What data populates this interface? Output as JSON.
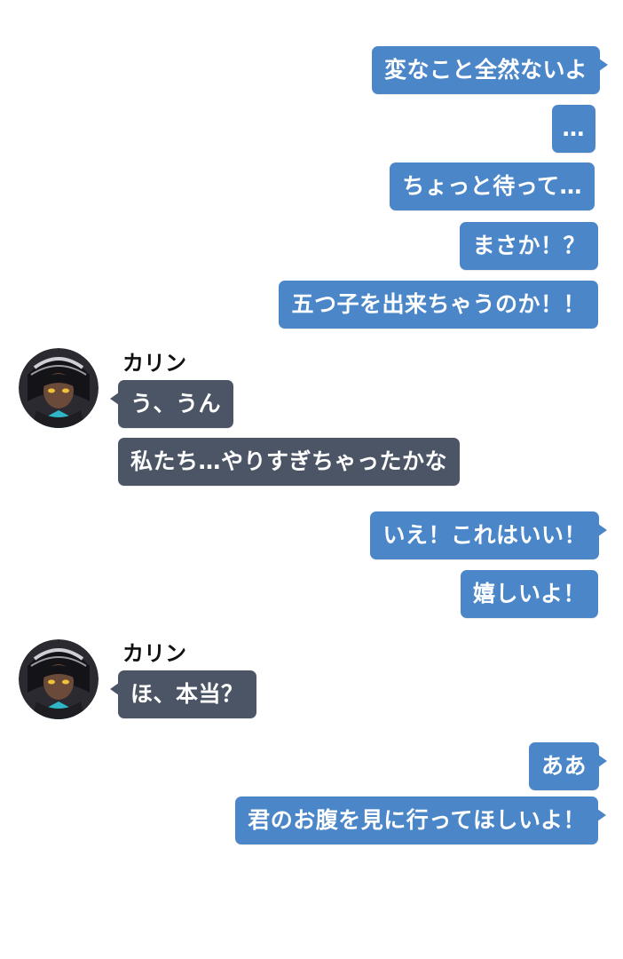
{
  "messages": [
    {
      "side": "me",
      "text": "変なこと全然ないよ"
    },
    {
      "side": "me",
      "text": "…"
    },
    {
      "side": "me",
      "text": "ちょっと待って…"
    },
    {
      "side": "me",
      "text": "まさか！？"
    },
    {
      "side": "me",
      "text": "五つ子を出来ちゃうのか！！"
    },
    {
      "side": "them",
      "sender": "カリン",
      "text": "う、うん"
    },
    {
      "side": "them",
      "text": "私たち…やりすぎちゃったかな"
    },
    {
      "side": "me",
      "text": "いえ！これはいい！"
    },
    {
      "side": "me",
      "text": "嬉しいよ！"
    },
    {
      "side": "them",
      "sender": "カリン",
      "text": "ほ、本当？"
    },
    {
      "side": "me",
      "text": "ああ"
    },
    {
      "side": "me",
      "text": "君のお腹を見に行ってほしいよ！"
    }
  ],
  "colors": {
    "outgoing_bubble": "#4a86c8",
    "incoming_bubble": "#4b5566",
    "bubble_text": "#ffffff",
    "name_text": "#111111",
    "background": "#ffffff"
  },
  "icons": {
    "avatar": "character-avatar-icon"
  }
}
